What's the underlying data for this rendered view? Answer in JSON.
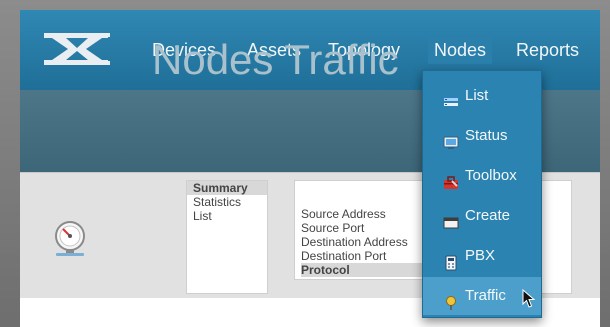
{
  "nav": {
    "items": [
      "Devices",
      "Assets",
      "Topology",
      "Nodes",
      "Reports"
    ],
    "active": "Nodes"
  },
  "page": {
    "title": "Nodes Traffic"
  },
  "toolbar": {
    "gauge_icon": "gauge-icon",
    "list1": [
      "Summary",
      "Statistics",
      "List"
    ],
    "list1_selected": "Summary",
    "list2": [
      "Source Address",
      "Source Port",
      "Destination Address",
      "Destination Port",
      "Protocol"
    ],
    "list2_selected": "Protocol"
  },
  "dropdown": {
    "items": [
      {
        "label": "List",
        "icon": "list-icon"
      },
      {
        "label": "Status",
        "icon": "monitor-icon"
      },
      {
        "label": "Toolbox",
        "icon": "toolbox-icon"
      },
      {
        "label": "Create",
        "icon": "window-icon"
      },
      {
        "label": "PBX",
        "icon": "phone-icon"
      },
      {
        "label": "Traffic",
        "icon": "pin-icon"
      }
    ],
    "hovered": "Traffic"
  },
  "colors": {
    "topbar": "#2a7fab",
    "titleband": "#466f82",
    "dropdown": "#2b83b1",
    "dropdown_hover": "#4c9fca"
  }
}
